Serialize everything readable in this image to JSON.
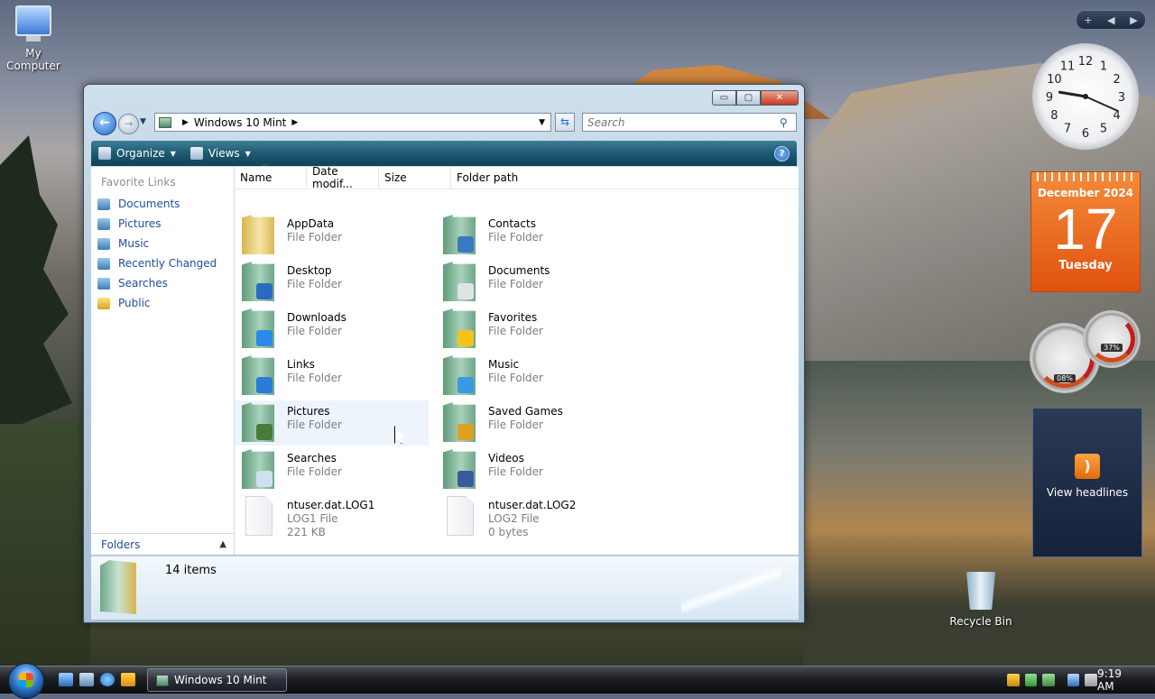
{
  "desktop": {
    "icons": [
      {
        "label_line1": "My",
        "label_line2": "Computer"
      },
      {
        "label": "Recycle Bin"
      }
    ]
  },
  "gadgets": {
    "sidebar_controls": {
      "add": "+",
      "prev": "◀",
      "next": "▶"
    },
    "clock": {
      "numbers": [
        "12",
        "1",
        "2",
        "3",
        "4",
        "5",
        "6",
        "7",
        "8",
        "9",
        "10",
        "11"
      ],
      "time": "9:19"
    },
    "calendar": {
      "month_year": "December 2024",
      "day": "17",
      "weekday": "Tuesday"
    },
    "cpu_meter": {
      "value": "08%"
    },
    "memory_meter": {
      "value": "37%"
    },
    "feed": {
      "label": "View headlines",
      "icon": "rss-icon"
    }
  },
  "window": {
    "controls": {
      "minimize": "▭",
      "maximize": "▢",
      "close": "✕"
    },
    "address": {
      "path_item": "Windows 10 Mint"
    },
    "search": {
      "placeholder": "Search"
    },
    "toolbar": {
      "organize": "Organize",
      "views": "Views",
      "help": "?"
    },
    "nav": {
      "heading": "Favorite Links",
      "links": [
        {
          "label": "Documents"
        },
        {
          "label": "Pictures"
        },
        {
          "label": "Music"
        },
        {
          "label": "Recently Changed"
        },
        {
          "label": "Searches"
        },
        {
          "label": "Public"
        }
      ],
      "folders_label": "Folders"
    },
    "columns": [
      "Name",
      "Date modif...",
      "Size",
      "Folder path"
    ],
    "items": [
      {
        "name": "AppData",
        "type": "File Folder"
      },
      {
        "name": "Contacts",
        "type": "File Folder"
      },
      {
        "name": "Desktop",
        "type": "File Folder"
      },
      {
        "name": "Documents",
        "type": "File Folder"
      },
      {
        "name": "Downloads",
        "type": "File Folder"
      },
      {
        "name": "Favorites",
        "type": "File Folder"
      },
      {
        "name": "Links",
        "type": "File Folder"
      },
      {
        "name": "Music",
        "type": "File Folder"
      },
      {
        "name": "Pictures",
        "type": "File Folder"
      },
      {
        "name": "Saved Games",
        "type": "File Folder"
      },
      {
        "name": "Searches",
        "type": "File Folder"
      },
      {
        "name": "Videos",
        "type": "File Folder"
      },
      {
        "name": "ntuser.dat.LOG1",
        "type": "LOG1 File",
        "size": "221 KB"
      },
      {
        "name": "ntuser.dat.LOG2",
        "type": "LOG2 File",
        "size": "0 bytes"
      }
    ],
    "details": {
      "count": "14 items"
    }
  },
  "taskbar": {
    "task_button": "Windows 10 Mint",
    "clock": "9:19 AM"
  }
}
